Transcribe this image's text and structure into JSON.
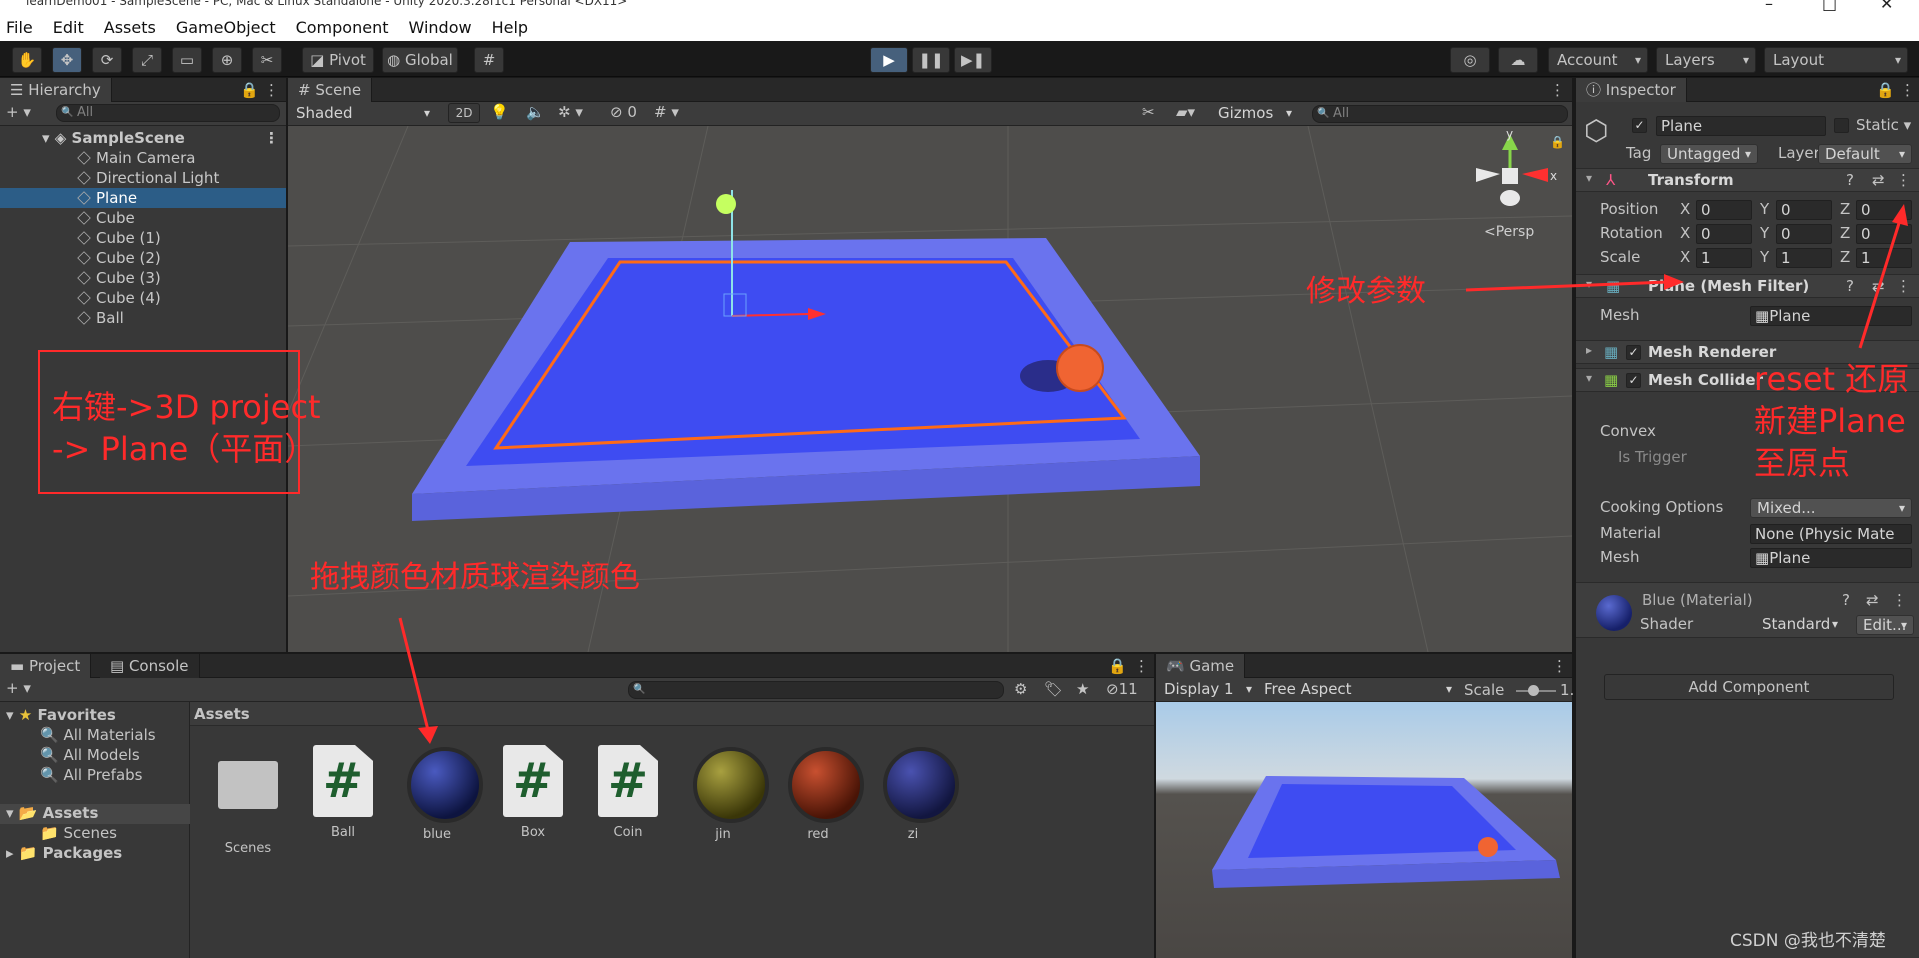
{
  "window": {
    "title": "learnDemo01 - SampleScene - PC, Mac & Linux Standalone - Unity 2020.3.28f1c1 Personal <DX11>"
  },
  "menu": [
    "File",
    "Edit",
    "Assets",
    "GameObject",
    "Component",
    "Window",
    "Help"
  ],
  "toolbar": {
    "pivot": "Pivot",
    "global": "Global",
    "account": "Account",
    "layers": "Layers",
    "layout": "Layout"
  },
  "hierarchy": {
    "tab": "Hierarchy",
    "search_placeholder": "All",
    "scene": "SampleScene",
    "items": [
      "Main Camera",
      "Directional Light",
      "Plane",
      "Cube",
      "Cube (1)",
      "Cube (2)",
      "Cube (3)",
      "Cube (4)",
      "Ball"
    ],
    "selected": "Plane"
  },
  "scene": {
    "tab": "Scene",
    "shading": "Shaded",
    "mode2d": "2D",
    "gizmos": "Gizmos",
    "search_placeholder": "All",
    "hidden_count": "0",
    "persp": "Persp",
    "axis_y": "y",
    "axis_x": "x"
  },
  "inspector": {
    "tab": "Inspector",
    "object_name": "Plane",
    "static_label": "Static",
    "tag_label": "Tag",
    "tag": "Untagged",
    "layer_label": "Layer",
    "layer": "Default",
    "transform": {
      "title": "Transform",
      "position": {
        "label": "Position",
        "x": "0",
        "y": "0",
        "z": "0"
      },
      "rotation": {
        "label": "Rotation",
        "x": "0",
        "y": "0",
        "z": "0"
      },
      "scale": {
        "label": "Scale",
        "x": "1",
        "y": "1",
        "z": "1"
      }
    },
    "mesh_filter": {
      "title": "Plane (Mesh Filter)",
      "mesh_label": "Mesh",
      "mesh": "Plane"
    },
    "mesh_renderer": {
      "title": "Mesh Renderer"
    },
    "mesh_collider": {
      "title": "Mesh Collider",
      "convex": "Convex",
      "is_trigger": "Is Trigger",
      "cooking_label": "Cooking Options",
      "cooking": "Mixed...",
      "material_label": "Material",
      "material": "None (Physic Mate",
      "mesh_label": "Mesh",
      "mesh": "Plane"
    },
    "material": {
      "name": "Blue (Material)",
      "shader_label": "Shader",
      "shader": "Standard",
      "edit": "Edit..."
    },
    "add_component": "Add Component"
  },
  "project": {
    "tab": "Project",
    "console_tab": "Console",
    "hidden_count": "11",
    "favorites": "Favorites",
    "fav_items": [
      "All Materials",
      "All Models",
      "All Prefabs"
    ],
    "assets": "Assets",
    "asset_folders": [
      "Scenes"
    ],
    "packages": "Packages",
    "breadcrumb": "Assets",
    "items": [
      {
        "name": "Scenes",
        "kind": "folder"
      },
      {
        "name": "Ball",
        "kind": "script"
      },
      {
        "name": "blue",
        "kind": "material",
        "color": "#1d2a6a"
      },
      {
        "name": "Box",
        "kind": "script"
      },
      {
        "name": "Coin",
        "kind": "script"
      },
      {
        "name": "jin",
        "kind": "material",
        "color": "#5f5b14"
      },
      {
        "name": "red",
        "kind": "material",
        "color": "#7a2310"
      },
      {
        "name": "zi",
        "kind": "material",
        "color": "#232a66"
      }
    ]
  },
  "game": {
    "tab": "Game",
    "display": "Display 1",
    "aspect": "Free Aspect",
    "scale_label": "Scale",
    "scale_value": "1."
  },
  "annotations": {
    "right_click": "右键->3D project\n-> Plane（平面）",
    "drag_material": "拖拽颜色材质球渲染颜色",
    "modify_params": "修改参数",
    "reset": "reset 还原\n新建Plane\n至原点",
    "watermark": "CSDN @我也不清楚"
  },
  "colors": {
    "selection": "#2c5d87",
    "plane_blue": "#3a4ef0",
    "annotation_red": "#ff2a2a"
  }
}
